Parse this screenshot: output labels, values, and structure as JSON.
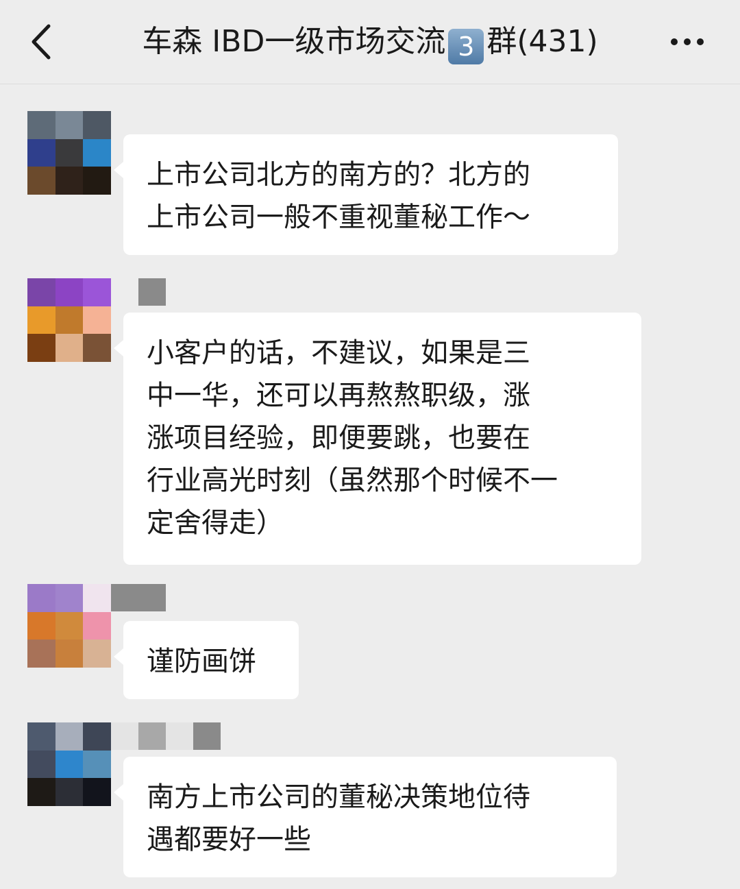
{
  "header": {
    "title_prefix": "车森 IBD一级市场交流",
    "group_number": "3",
    "title_suffix": "群(431)",
    "back_icon": "chevron-left-icon",
    "more_icon": "more-dots-icon"
  },
  "messages": [
    {
      "avatar_colors": [
        "#5e6b78",
        "#7a8896",
        "#4e5864",
        "#2f3f8c",
        "#3a3a3c",
        "#2b86c8",
        "#6b4a2c",
        "#2f221a",
        "#221a12"
      ],
      "nickname_colors": [],
      "lines": [
        "上市公司北方的南方的？北方的",
        "上市公司一般不重视董秘工作～"
      ]
    },
    {
      "avatar_colors": [
        "#7a45a8",
        "#8c44c4",
        "#9b55d8",
        "#e89a2a",
        "#c07a2c",
        "#f5b295",
        "#7a3e12",
        "#e0b08a",
        "#7a5236"
      ],
      "nickname_colors": [
        "#ededed",
        "#8a8a8a"
      ],
      "lines": [
        "小客户的话，不建议，如果是三",
        "中一华，还可以再熬熬职级，涨",
        "涨项目经验，即便要跳，也要在",
        "行业高光时刻（虽然那个时候不一",
        "定舍得走）"
      ]
    },
    {
      "avatar_colors": [
        "#9b7ac8",
        "#a083cc",
        "#f0e4ee",
        "#d8782a",
        "#d08a3c",
        "#ee93ab",
        "#a87258",
        "#c8803c",
        "#d8b294"
      ],
      "nickname_colors": [
        "#8a8a8a",
        "#8a8a8a"
      ],
      "lines": [
        "谨防画饼"
      ]
    },
    {
      "avatar_colors": [
        "#4e5a6e",
        "#a7aebb",
        "#3e4656",
        "#434b5e",
        "#2e86cc",
        "#5690b8",
        "#1e1a16",
        "#2c2e36",
        "#12141c"
      ],
      "nickname_colors": [
        "#e4e4e4",
        "#a8a8a8",
        "#e4e4e4",
        "#8a8a8a"
      ],
      "lines": [
        "南方上市公司的董秘决策地位待",
        "遇都要好一些"
      ]
    }
  ]
}
